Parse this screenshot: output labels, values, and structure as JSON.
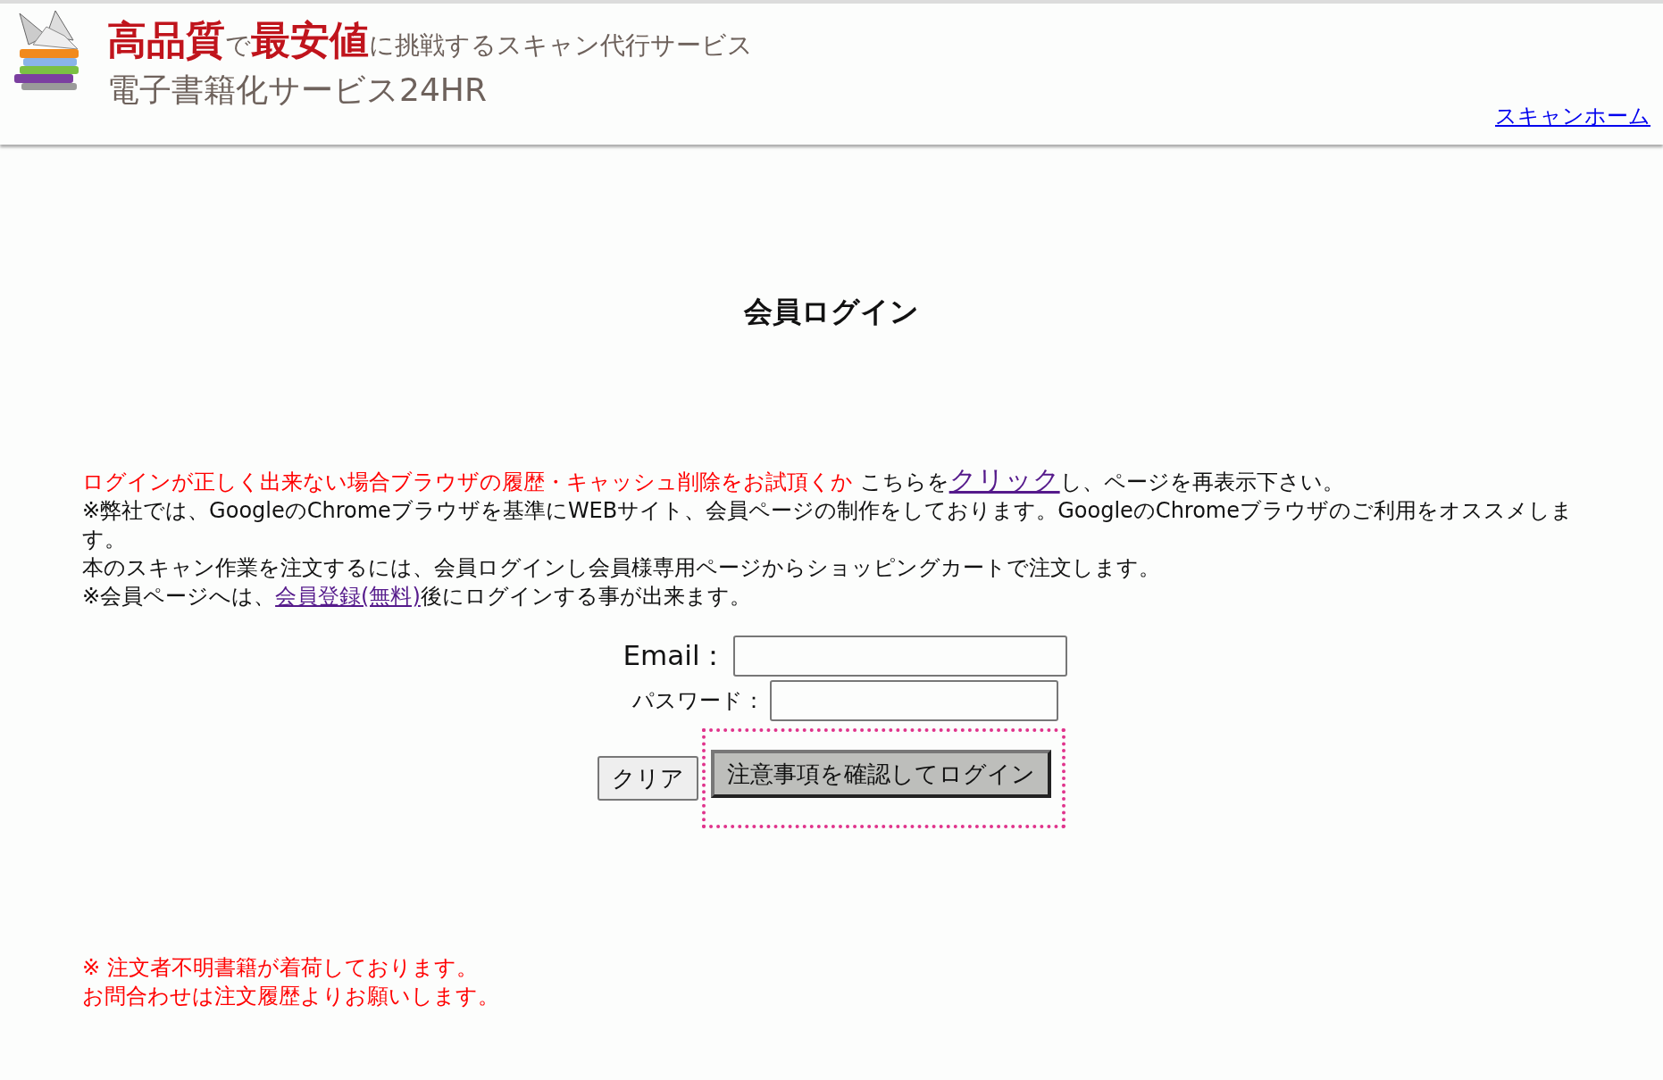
{
  "header": {
    "tagline": [
      {
        "text": "高品質",
        "kind": "emphasis"
      },
      {
        "text": "で",
        "kind": "plain"
      },
      {
        "text": "最安値",
        "kind": "emphasis"
      },
      {
        "text": "に挑戦するスキャン代行サービス",
        "kind": "plain"
      }
    ],
    "service_name": "電子書籍化サービス24HR",
    "home_link": "スキャンホーム"
  },
  "title": "会員ログイン",
  "notice": {
    "warning": "ログインが正しく出来ない場合ブラウザの履歴・キャッシュ削除をお試頂くか",
    "before_link": "こちらを",
    "link": "クリック",
    "after_link": "し、ページを再表示下さい。"
  },
  "paragraphs": [
    "※弊社では、GoogleのChromeブラウザを基準にWEBサイト、会員ページの制作をしております。GoogleのChromeブラウザのご利用をオススメします。",
    "本のスキャン作業を注文するには、会員ログインし会員様専用ページからショッピングカートで注文します。"
  ],
  "registration": {
    "before_link": "※会員ページへは、",
    "link": "会員登録(無料)",
    "after_link": "後にログインする事が出来ます。"
  },
  "form": {
    "email_label": "Email：",
    "password_label": "パスワード：",
    "clear_button": "クリア",
    "login_button": "注意事項を確認してログイン"
  },
  "footer_notice": [
    "※ 注文者不明書籍が着荷しております。",
    "お問合わせは注文履歴よりお願いします。"
  ]
}
